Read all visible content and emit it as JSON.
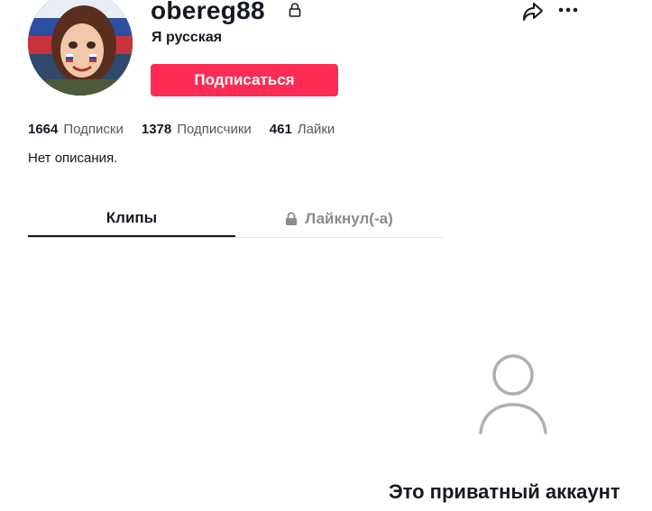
{
  "profile": {
    "username": "obereg88",
    "subtitle": "Я русская",
    "follow_label": "Подписаться",
    "bio": "Нет описания."
  },
  "stats": [
    {
      "value": "1664",
      "label": "Подписки"
    },
    {
      "value": "1378",
      "label": "Подписчики"
    },
    {
      "value": "461",
      "label": "Лайки"
    }
  ],
  "tabs": [
    {
      "label": "Клипы",
      "active": true
    },
    {
      "label": "Лайкнул(-а)",
      "active": false,
      "locked": true
    }
  ],
  "empty_state": {
    "title": "Это приватный аккаунт",
    "icon": "user-icon"
  },
  "colors": {
    "accent": "#fe2c55",
    "text": "#161823",
    "muted": "#8a8b91"
  }
}
